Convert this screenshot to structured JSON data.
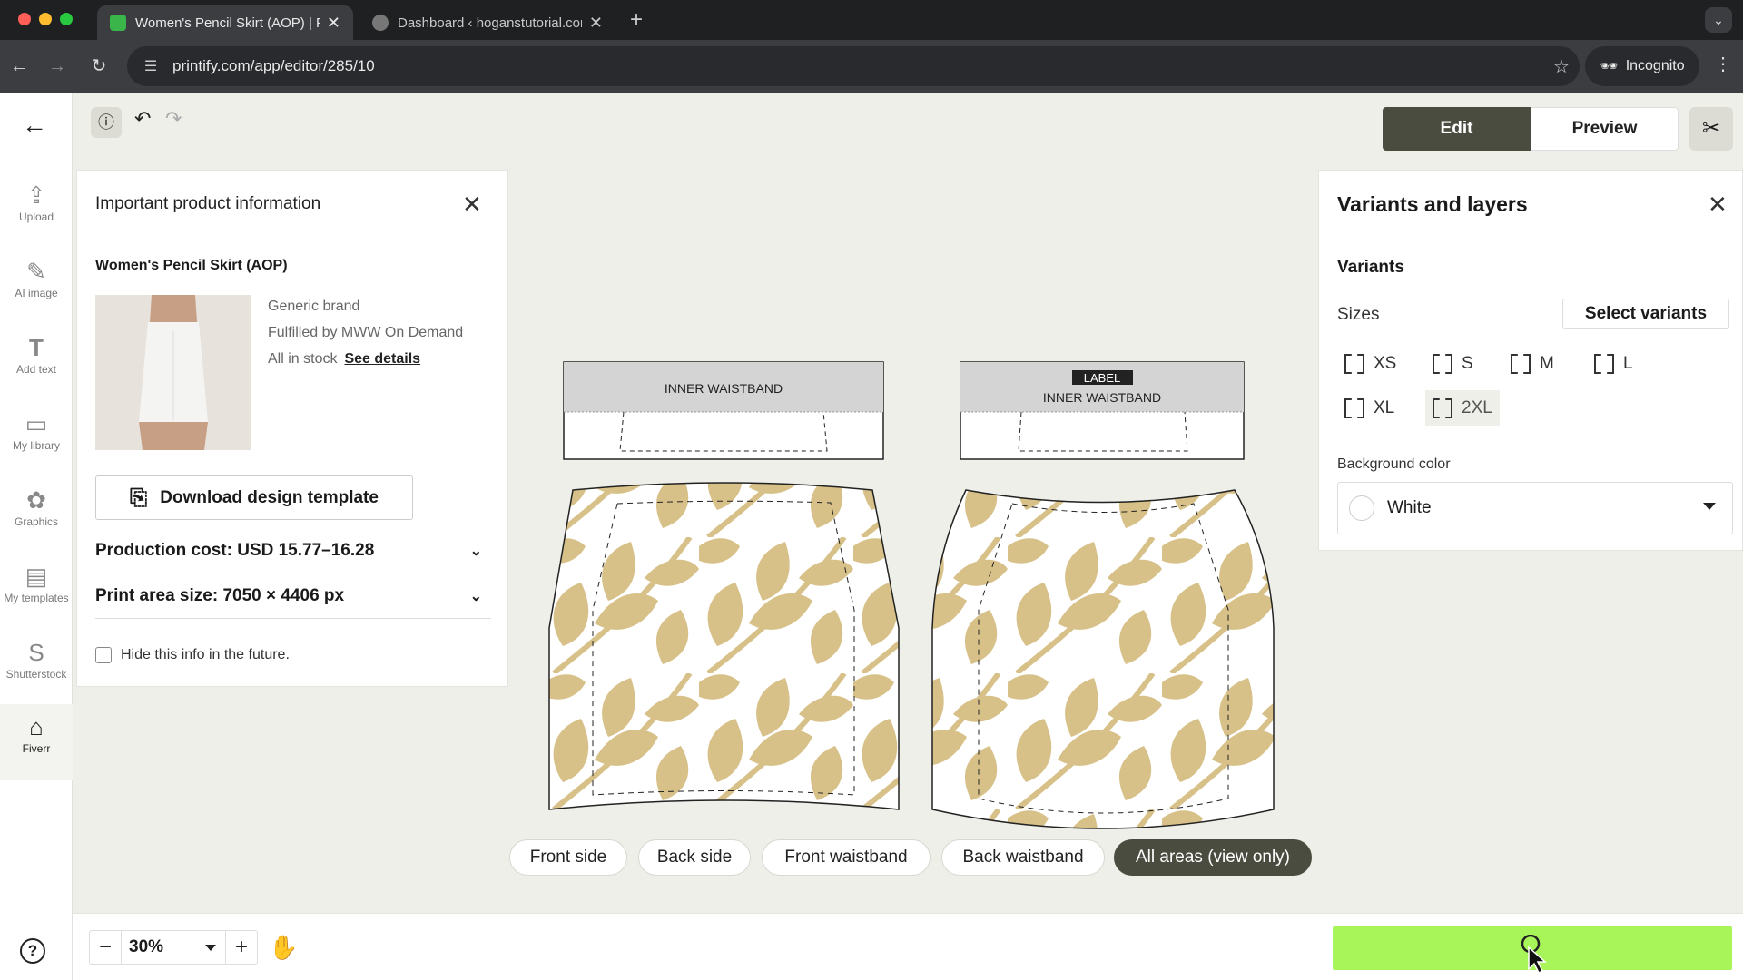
{
  "browser": {
    "tabs": [
      {
        "title": "Women's Pencil Skirt (AOP) | Printify",
        "active": true
      },
      {
        "title": "Dashboard ‹ hoganstutorial.com",
        "active": false
      }
    ],
    "url": "printify.com/app/editor/285/10",
    "incognito_label": "Incognito"
  },
  "rail": {
    "items": [
      {
        "label": "Upload",
        "icon": "upload-icon"
      },
      {
        "label": "AI image",
        "icon": "magic-wand-icon"
      },
      {
        "label": "Add text",
        "icon": "text-icon"
      },
      {
        "label": "My library",
        "icon": "folder-icon"
      },
      {
        "label": "Graphics",
        "icon": "flower-icon"
      },
      {
        "label": "My templates",
        "icon": "templates-icon"
      },
      {
        "label": "Shutterstock",
        "icon": "shutterstock-icon"
      },
      {
        "label": "Fiverr",
        "icon": "fiverr-icon"
      }
    ]
  },
  "header": {
    "edit_label": "Edit",
    "preview_label": "Preview"
  },
  "info_panel": {
    "title": "Important product information",
    "product_name": "Women's Pencil Skirt (AOP)",
    "brand": "Generic brand",
    "fulfilled_by": "Fulfilled by MWW On Demand",
    "stock": "All in stock",
    "see_details": "See details",
    "download_label": "Download design template",
    "production_cost": "Production cost: USD 15.77–16.28",
    "print_area": "Print area size: 7050 × 4406 px",
    "hide_info": "Hide this info in the future."
  },
  "canvas": {
    "front_waistband_label": "INNER WAISTBAND",
    "back_tag_label": "LABEL",
    "back_waistband_label": "INNER WAISTBAND",
    "pattern_color": "#d7c189"
  },
  "variants_panel": {
    "title": "Variants and layers",
    "variants_heading": "Variants",
    "sizes_label": "Sizes",
    "select_variants": "Select variants",
    "sizes": [
      "XS",
      "S",
      "M",
      "L",
      "XL",
      "2XL"
    ],
    "background_label": "Background color",
    "background_value": "White"
  },
  "area_tabs": [
    "Front side",
    "Back side",
    "Front waistband",
    "Back waistband",
    "All areas (view only)"
  ],
  "bottom": {
    "zoom": "30%"
  },
  "colors": {
    "accent_dark": "#4a4c3f",
    "highlight_green": "#a8f55a"
  }
}
